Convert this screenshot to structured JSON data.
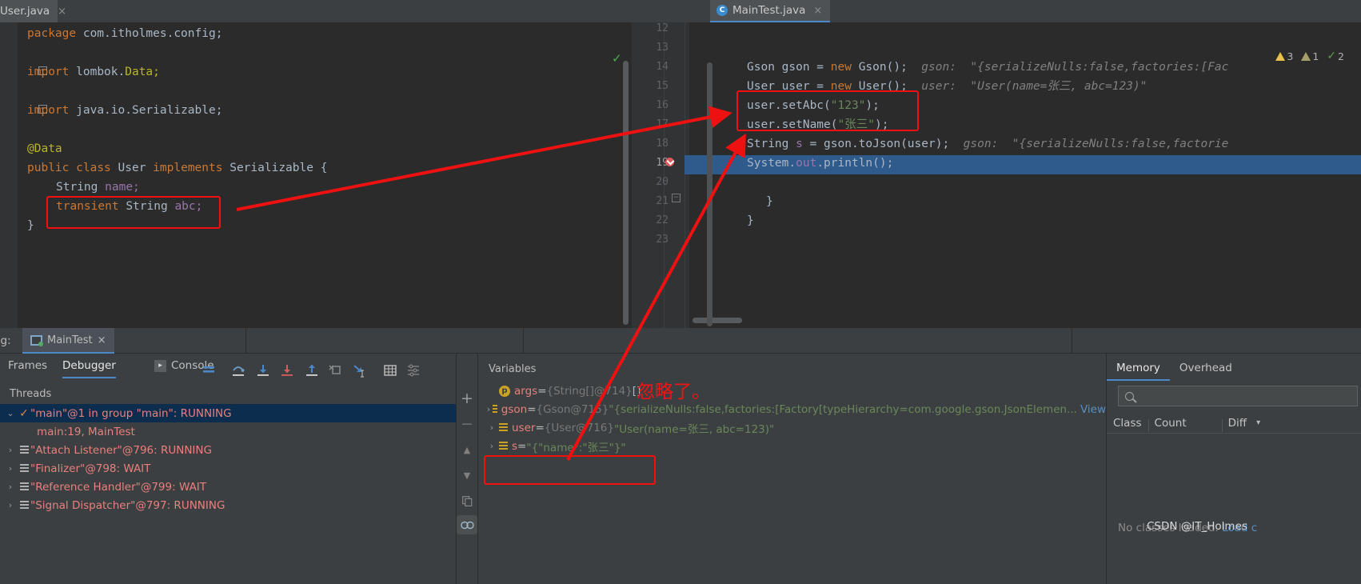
{
  "editor_tabs": {
    "left": {
      "label": "User.java",
      "close": "×"
    },
    "right": {
      "label": "MainTest.java",
      "close": "×",
      "icon": "java-class-icon",
      "badge": "C"
    }
  },
  "left_editor": {
    "lines": [
      "package com.itholmes.config;",
      "import lombok.Data;",
      "import java.io.Serializable;",
      "@Data",
      "public class User implements Serializable {",
      "String name;",
      "transient String abc;",
      "}"
    ],
    "tokens": {
      "package_kw": "package",
      "package_name": "com.itholmes.config;",
      "import_kw": "import",
      "import1": "lombok.",
      "import1_cls": "Data;",
      "import2": "java.io.Serializable;",
      "annotation": "@Data",
      "public_kw": "public",
      "class_kw": "class",
      "class_name": "User",
      "implements_kw": "implements",
      "interface_name": "Serializable {",
      "type_string": "String",
      "field_name": "name;",
      "transient_kw": "transient",
      "type_string2": "String",
      "field_abc": "abc;",
      "close_brace": "}"
    },
    "ok_check": "✓"
  },
  "right_editor": {
    "line_numbers": [
      "12",
      "13",
      "14",
      "15",
      "16",
      "17",
      "18",
      "19",
      "20",
      "21",
      "22",
      "23"
    ],
    "code": {
      "l14": {
        "type": "Gson",
        "var": " gson = ",
        "kw": "new",
        "ctor": " Gson();",
        "hint": "gson:  \"{serializeNulls:false,factories:[Fac"
      },
      "l15": {
        "type": "User",
        "var": " user = ",
        "kw": "new",
        "ctor": " User();",
        "hint": "user:  \"User(name=张三, abc=123)\""
      },
      "l16": {
        "text": "user.setAbc(",
        "str": "\"123\"",
        "tail": ");"
      },
      "l17": {
        "text": "user.setName(",
        "str": "\"张三\"",
        "tail": ");"
      },
      "l18": {
        "type": "String",
        "var": " s",
        "eq": " = gson.toJson(user);",
        "hint": "gson:  \"{serializeNulls:false,factorie"
      },
      "l19": {
        "a": "System.",
        "b": "out",
        "c": ".println();"
      },
      "l21": "}",
      "l22": "}"
    },
    "breakpoint_line": "19",
    "inspections": {
      "warnings": "3",
      "weak_warnings": "1",
      "ok": "2"
    }
  },
  "debug_window": {
    "label": "ug:",
    "run_tab": {
      "label": "MainTest",
      "close": "×",
      "icon": "run-configuration-icon"
    },
    "tabs": [
      {
        "label": "Frames",
        "selected": false
      },
      {
        "label": "Debugger",
        "selected": true
      },
      {
        "label": "Console",
        "selected": false
      }
    ],
    "toolbar_icons": [
      "mute-breakpoints-icon",
      "step-over-icon",
      "step-into-icon",
      "force-step-into-icon",
      "step-out-icon",
      "drop-frame-icon",
      "run-to-cursor-icon",
      "evaluate-expression-icon",
      "settings-icon"
    ]
  },
  "threads": {
    "title": "Threads",
    "rows": [
      {
        "label": "\"main\"@1 in group \"main\": RUNNING",
        "selected": true,
        "expanded": true,
        "icon": "thread-running-check-icon"
      },
      {
        "label": "main:19, MainTest",
        "frame": true
      },
      {
        "label": "\"Attach Listener\"@796: RUNNING",
        "icon": "thread-stack-icon"
      },
      {
        "label": "\"Finalizer\"@798: WAIT",
        "icon": "thread-stack-icon"
      },
      {
        "label": "\"Reference Handler\"@799: WAIT",
        "icon": "thread-stack-icon"
      },
      {
        "label": "\"Signal Dispatcher\"@797: RUNNING",
        "icon": "thread-stack-icon"
      }
    ]
  },
  "vars_toolbar": {
    "add": "+",
    "remove": "−",
    "up": "▲",
    "down": "▼",
    "copy": "copy-icon",
    "link": "link-icon"
  },
  "variables": {
    "title": "Variables",
    "rows": [
      {
        "icon": "parameter-icon",
        "badge": "p",
        "name": "args",
        "eq": " = ",
        "type": "{String[]@714}",
        "value": " []",
        "chevron": ""
      },
      {
        "icon": "object-icon",
        "name": "gson",
        "eq": " = ",
        "type": "{Gson@715}",
        "value": " \"{serializeNulls:false,factories:[Factory[typeHierarchy=com.google.gson.JsonElemen...",
        "link": "View",
        "chevron": "›"
      },
      {
        "icon": "object-icon",
        "name": "user",
        "eq": " = ",
        "type": "{User@716}",
        "value": " \"User(name=张三, abc=123)\"",
        "chevron": "›"
      },
      {
        "icon": "object-icon",
        "name": "s",
        "eq": " = ",
        "type": "",
        "value": "\"{\"name\":\"张三\"}\"",
        "chevron": "›",
        "highlighted": true
      }
    ]
  },
  "memory_panel": {
    "tabs": [
      {
        "label": "Memory",
        "selected": true
      },
      {
        "label": "Overhead",
        "selected": false
      }
    ],
    "search_placeholder": "",
    "columns": [
      "Class",
      "Count",
      "Diff"
    ],
    "sort_arrow": "▾",
    "empty_text": "No classes loaded.",
    "empty_link": "Load c"
  },
  "annotations": {
    "chinese_note": "忽略了。",
    "watermark": "CSDN @IT_Holmes",
    "highlight_color": "#ee1111"
  }
}
